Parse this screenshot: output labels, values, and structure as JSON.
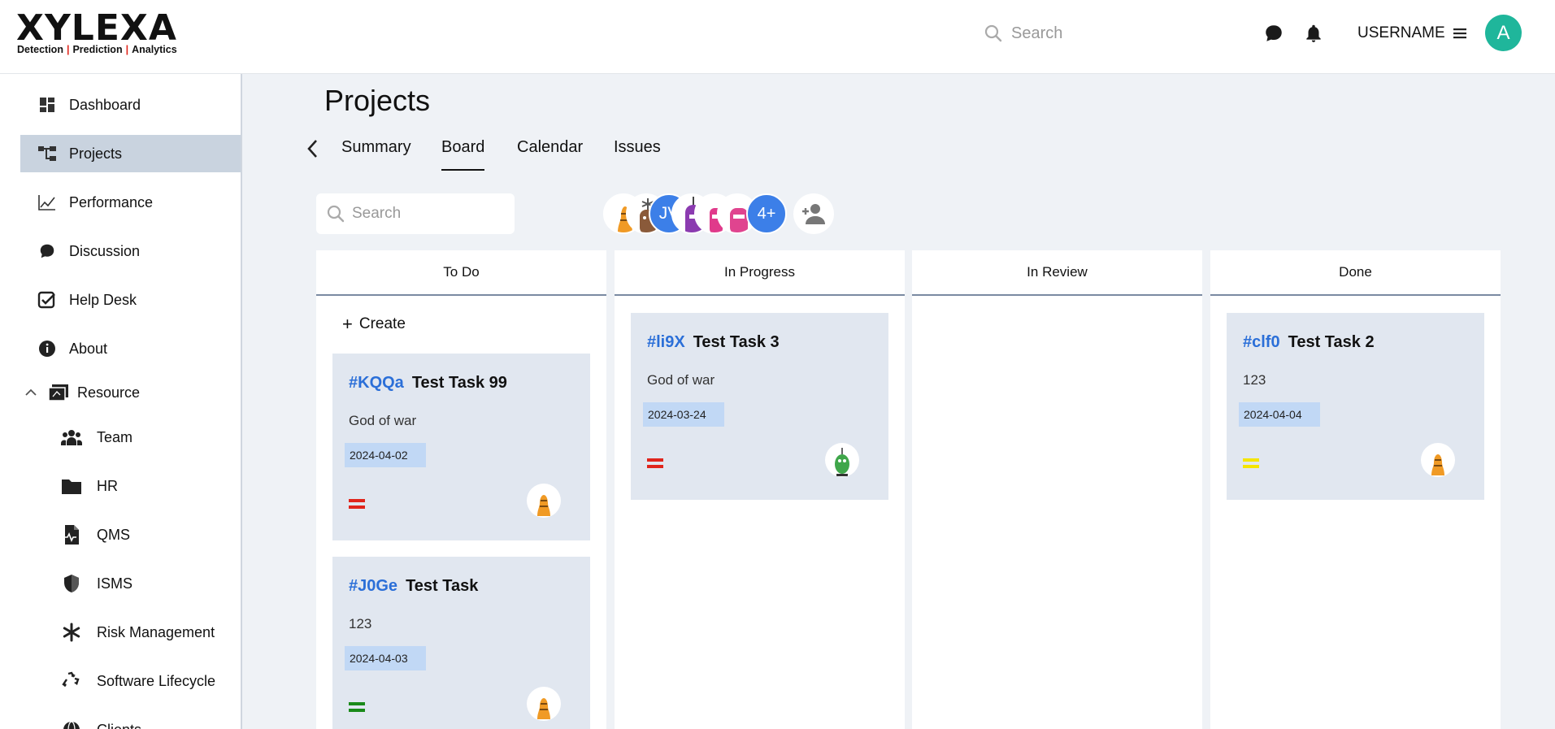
{
  "brand": {
    "name_left": "X",
    "name_rest": "YLEXA",
    "tagline_parts": [
      "Detection",
      "Prediction",
      "Analytics"
    ],
    "tagline_sep": "|"
  },
  "header": {
    "search_placeholder": "Search",
    "username": "USERNAME",
    "avatar_initial": "A",
    "icons": [
      "chat-icon",
      "bell-icon",
      "menu-icon"
    ]
  },
  "sidebar": {
    "items": [
      {
        "label": "Dashboard",
        "icon": "dashboard-icon"
      },
      {
        "label": "Projects",
        "icon": "projects-icon",
        "active": true
      },
      {
        "label": "Performance",
        "icon": "performance-icon"
      },
      {
        "label": "Discussion",
        "icon": "discussion-icon"
      },
      {
        "label": "Help Desk",
        "icon": "help-desk-icon"
      },
      {
        "label": "About",
        "icon": "info-icon"
      },
      {
        "label": "Resource",
        "icon": "resource-icon",
        "expanded": true
      }
    ],
    "sub_items": [
      {
        "label": "Team",
        "icon": "team-icon"
      },
      {
        "label": "HR",
        "icon": "folder-icon"
      },
      {
        "label": "QMS",
        "icon": "document-icon"
      },
      {
        "label": "ISMS",
        "icon": "shield-icon"
      },
      {
        "label": "Risk Management",
        "icon": "asterisk-icon"
      },
      {
        "label": "Software Lifecycle",
        "icon": "recycle-icon"
      },
      {
        "label": "Clients",
        "icon": "globe-icon"
      }
    ]
  },
  "page": {
    "title": "Projects",
    "tabs": [
      {
        "label": "Summary"
      },
      {
        "label": "Board",
        "active": true
      },
      {
        "label": "Calendar"
      },
      {
        "label": "Issues"
      }
    ],
    "board_search_placeholder": "Search",
    "members_initials": "JV",
    "members_more": "4+"
  },
  "columns": [
    {
      "title": "To Do",
      "create_label": "Create"
    },
    {
      "title": "In Progress"
    },
    {
      "title": "In Review"
    },
    {
      "title": "Done"
    }
  ],
  "cards": {
    "todo": [
      {
        "id": "#KQQa",
        "title": "Test Task 99",
        "desc": "God of war",
        "date": "2024-04-02",
        "priority_color": "#e0251c"
      },
      {
        "id": "#J0Ge",
        "title": "Test Task",
        "desc": "123",
        "date": "2024-04-03",
        "priority_color": "#1a8a1a"
      }
    ],
    "in_progress": [
      {
        "id": "#li9X",
        "title": "Test Task 3",
        "desc": "God of war",
        "date": "2024-03-24",
        "priority_color": "#e0251c"
      }
    ],
    "done": [
      {
        "id": "#clf0",
        "title": "Test Task 2",
        "desc": "123",
        "date": "2024-04-04",
        "priority_color": "#f5e500"
      }
    ]
  },
  "colors": {
    "accent_teal": "#1fb69b",
    "id_blue": "#2b6fd8",
    "card_bg": "#e1e7f0",
    "date_bg": "#c1d8f5",
    "active_nav": "#c9d3df"
  }
}
